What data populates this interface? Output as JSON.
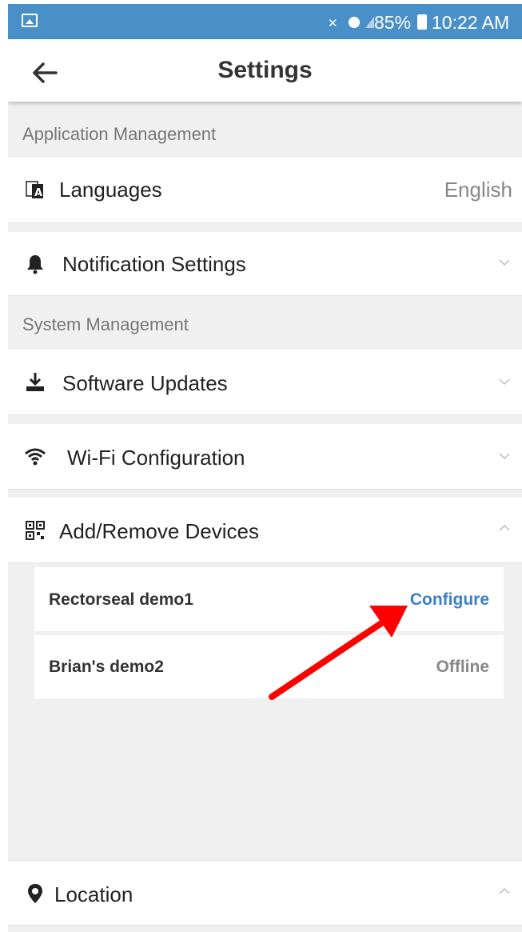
{
  "status_bar": {
    "battery_percent": "85%",
    "time": "10:22 AM",
    "icons": [
      "gallery-icon",
      "mute-icon",
      "alarm-icon",
      "wifi-icon",
      "signal-icon",
      "battery-icon"
    ]
  },
  "header": {
    "title": "Settings"
  },
  "sections": {
    "application_management": "Application Management",
    "system_management": "System Management"
  },
  "rows": {
    "languages": {
      "label": "Languages",
      "value": "English",
      "icon": "translate-icon"
    },
    "notification_settings": {
      "label": "Notification Settings",
      "icon": "bell-icon",
      "expanded": false
    },
    "software_updates": {
      "label": "Software Updates",
      "icon": "download-icon",
      "expanded": false
    },
    "wifi_configuration": {
      "label": "Wi-Fi Configuration",
      "icon": "wifi-icon",
      "expanded": false
    },
    "add_remove_devices": {
      "label": "Add/Remove Devices",
      "icon": "qr-code-icon",
      "expanded": true
    },
    "location": {
      "label": "Location",
      "icon": "map-pin-icon",
      "expanded": true
    }
  },
  "devices": [
    {
      "name": "Rectorseal demo1",
      "action": "Configure",
      "action_color": "#3b7fc4"
    },
    {
      "name": "Brian's demo2",
      "action": "Offline",
      "action_color": "#888888"
    }
  ],
  "annotation": {
    "color": "#ff0000",
    "points_to": "Configure"
  }
}
